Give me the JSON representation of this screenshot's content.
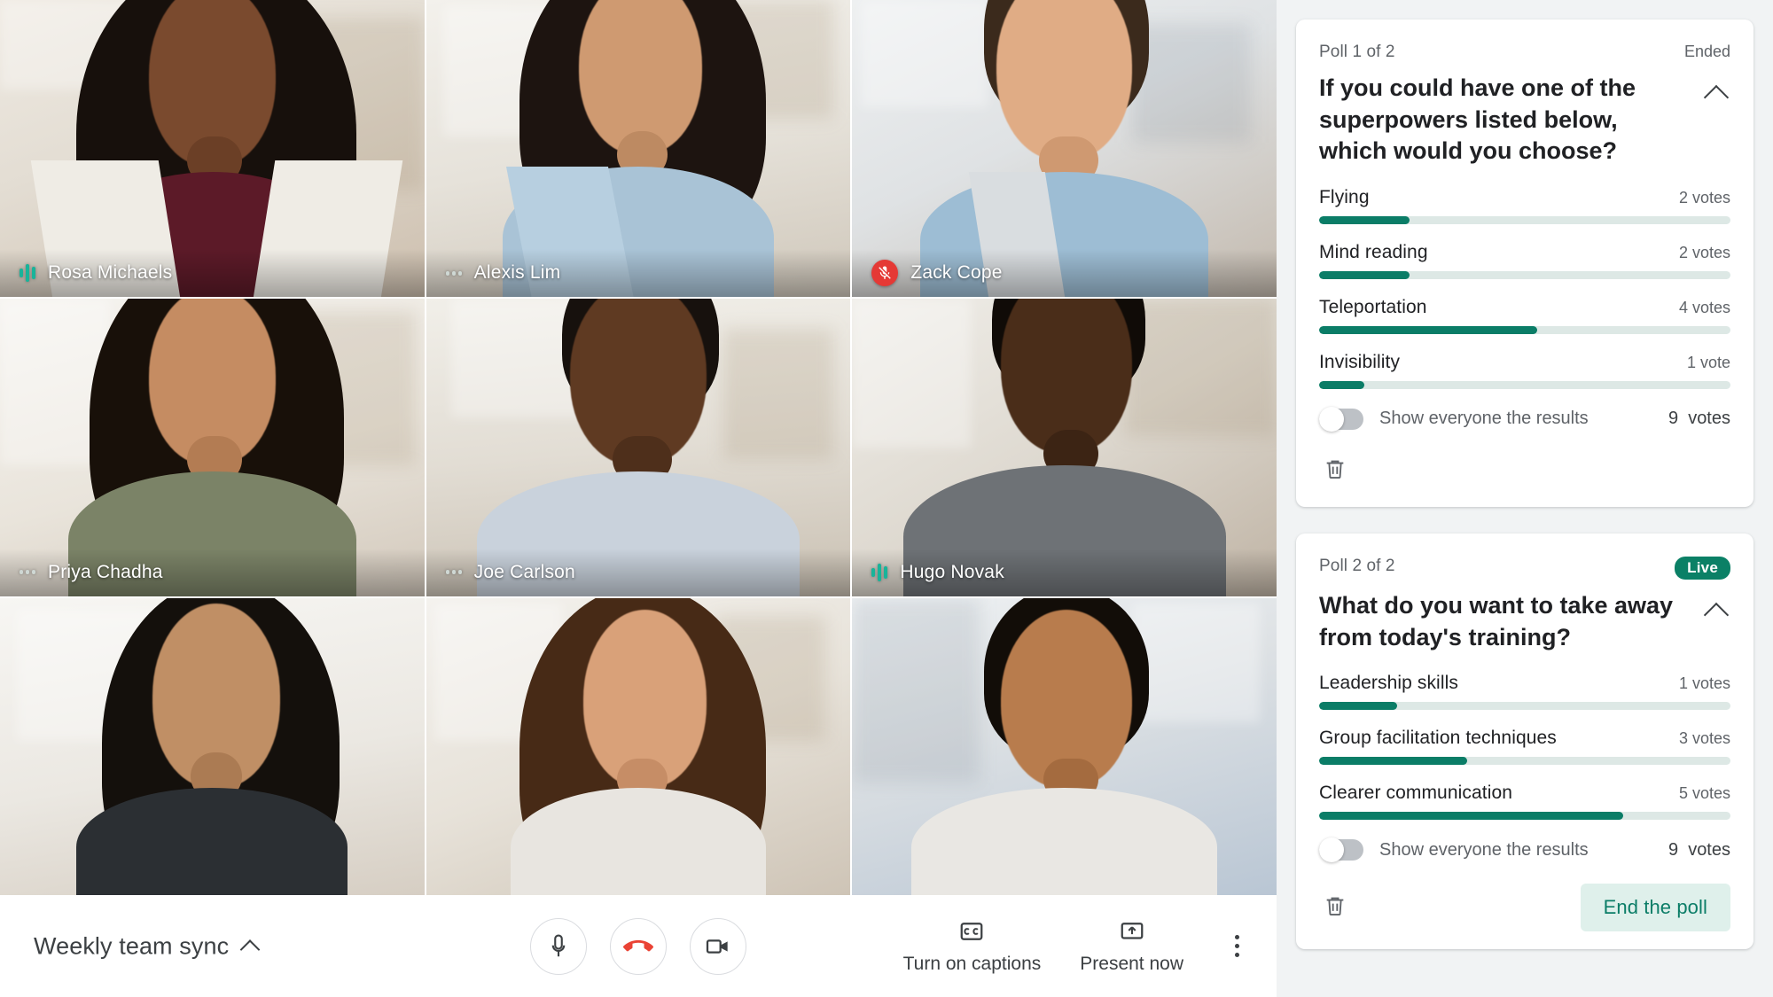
{
  "meeting": {
    "title": "Weekly team sync",
    "controls": {
      "mic": "microphone-button",
      "hangup": "end-call-button",
      "camera": "camera-button",
      "captions_label": "Turn on captions",
      "present_label": "Present now",
      "more_label": "more-options"
    }
  },
  "participants": [
    {
      "name": "Rosa Michaels",
      "mic": "speaking"
    },
    {
      "name": "Alexis Lim",
      "mic": "idle"
    },
    {
      "name": "Zack Cope",
      "mic": "muted"
    },
    {
      "name": "Priya Chadha",
      "mic": "idle"
    },
    {
      "name": "Joe Carlson",
      "mic": "idle"
    },
    {
      "name": "Hugo Novak",
      "mic": "speaking"
    },
    {
      "name": "",
      "mic": "none"
    },
    {
      "name": "",
      "mic": "none"
    },
    {
      "name": "",
      "mic": "none"
    }
  ],
  "polls": [
    {
      "index_label": "Poll 1 of 2",
      "status_label": "Ended",
      "status_kind": "ended",
      "question": "If you could have one of the superpowers listed below, which would you choose?",
      "options": [
        {
          "label": "Flying",
          "votes_label": "2 votes",
          "votes": 2,
          "percent": 22
        },
        {
          "label": "Mind reading",
          "votes_label": "2 votes",
          "votes": 2,
          "percent": 22
        },
        {
          "label": "Teleportation",
          "votes_label": "4 votes",
          "votes": 4,
          "percent": 53
        },
        {
          "label": "Invisibility",
          "votes_label": "1 vote",
          "votes": 1,
          "percent": 11
        }
      ],
      "toggle_label": "Show everyone the results",
      "toggle_on": false,
      "total_count": "9",
      "total_unit": "votes",
      "delete_icon": "trash-icon",
      "action_label": null
    },
    {
      "index_label": "Poll 2 of 2",
      "status_label": "Live",
      "status_kind": "live",
      "question": "What do you want to take away from today's training?",
      "options": [
        {
          "label": "Leadership skills",
          "votes_label": "1 votes",
          "votes": 1,
          "percent": 19
        },
        {
          "label": "Group facilitation techniques",
          "votes_label": "3 votes",
          "votes": 3,
          "percent": 36
        },
        {
          "label": "Clearer communication",
          "votes_label": "5 votes",
          "votes": 5,
          "percent": 74
        }
      ],
      "toggle_label": "Show everyone the results",
      "toggle_on": false,
      "total_count": "9",
      "total_unit": "votes",
      "delete_icon": "trash-icon",
      "action_label": "End the poll"
    }
  ],
  "colors": {
    "accent_green": "#0b7d67",
    "bar_track": "#dde8e5",
    "live_badge": "#0b8066",
    "button_bg": "#dff0eb",
    "hangup_red": "#e53935",
    "panel_bg": "#f1f3f4"
  }
}
